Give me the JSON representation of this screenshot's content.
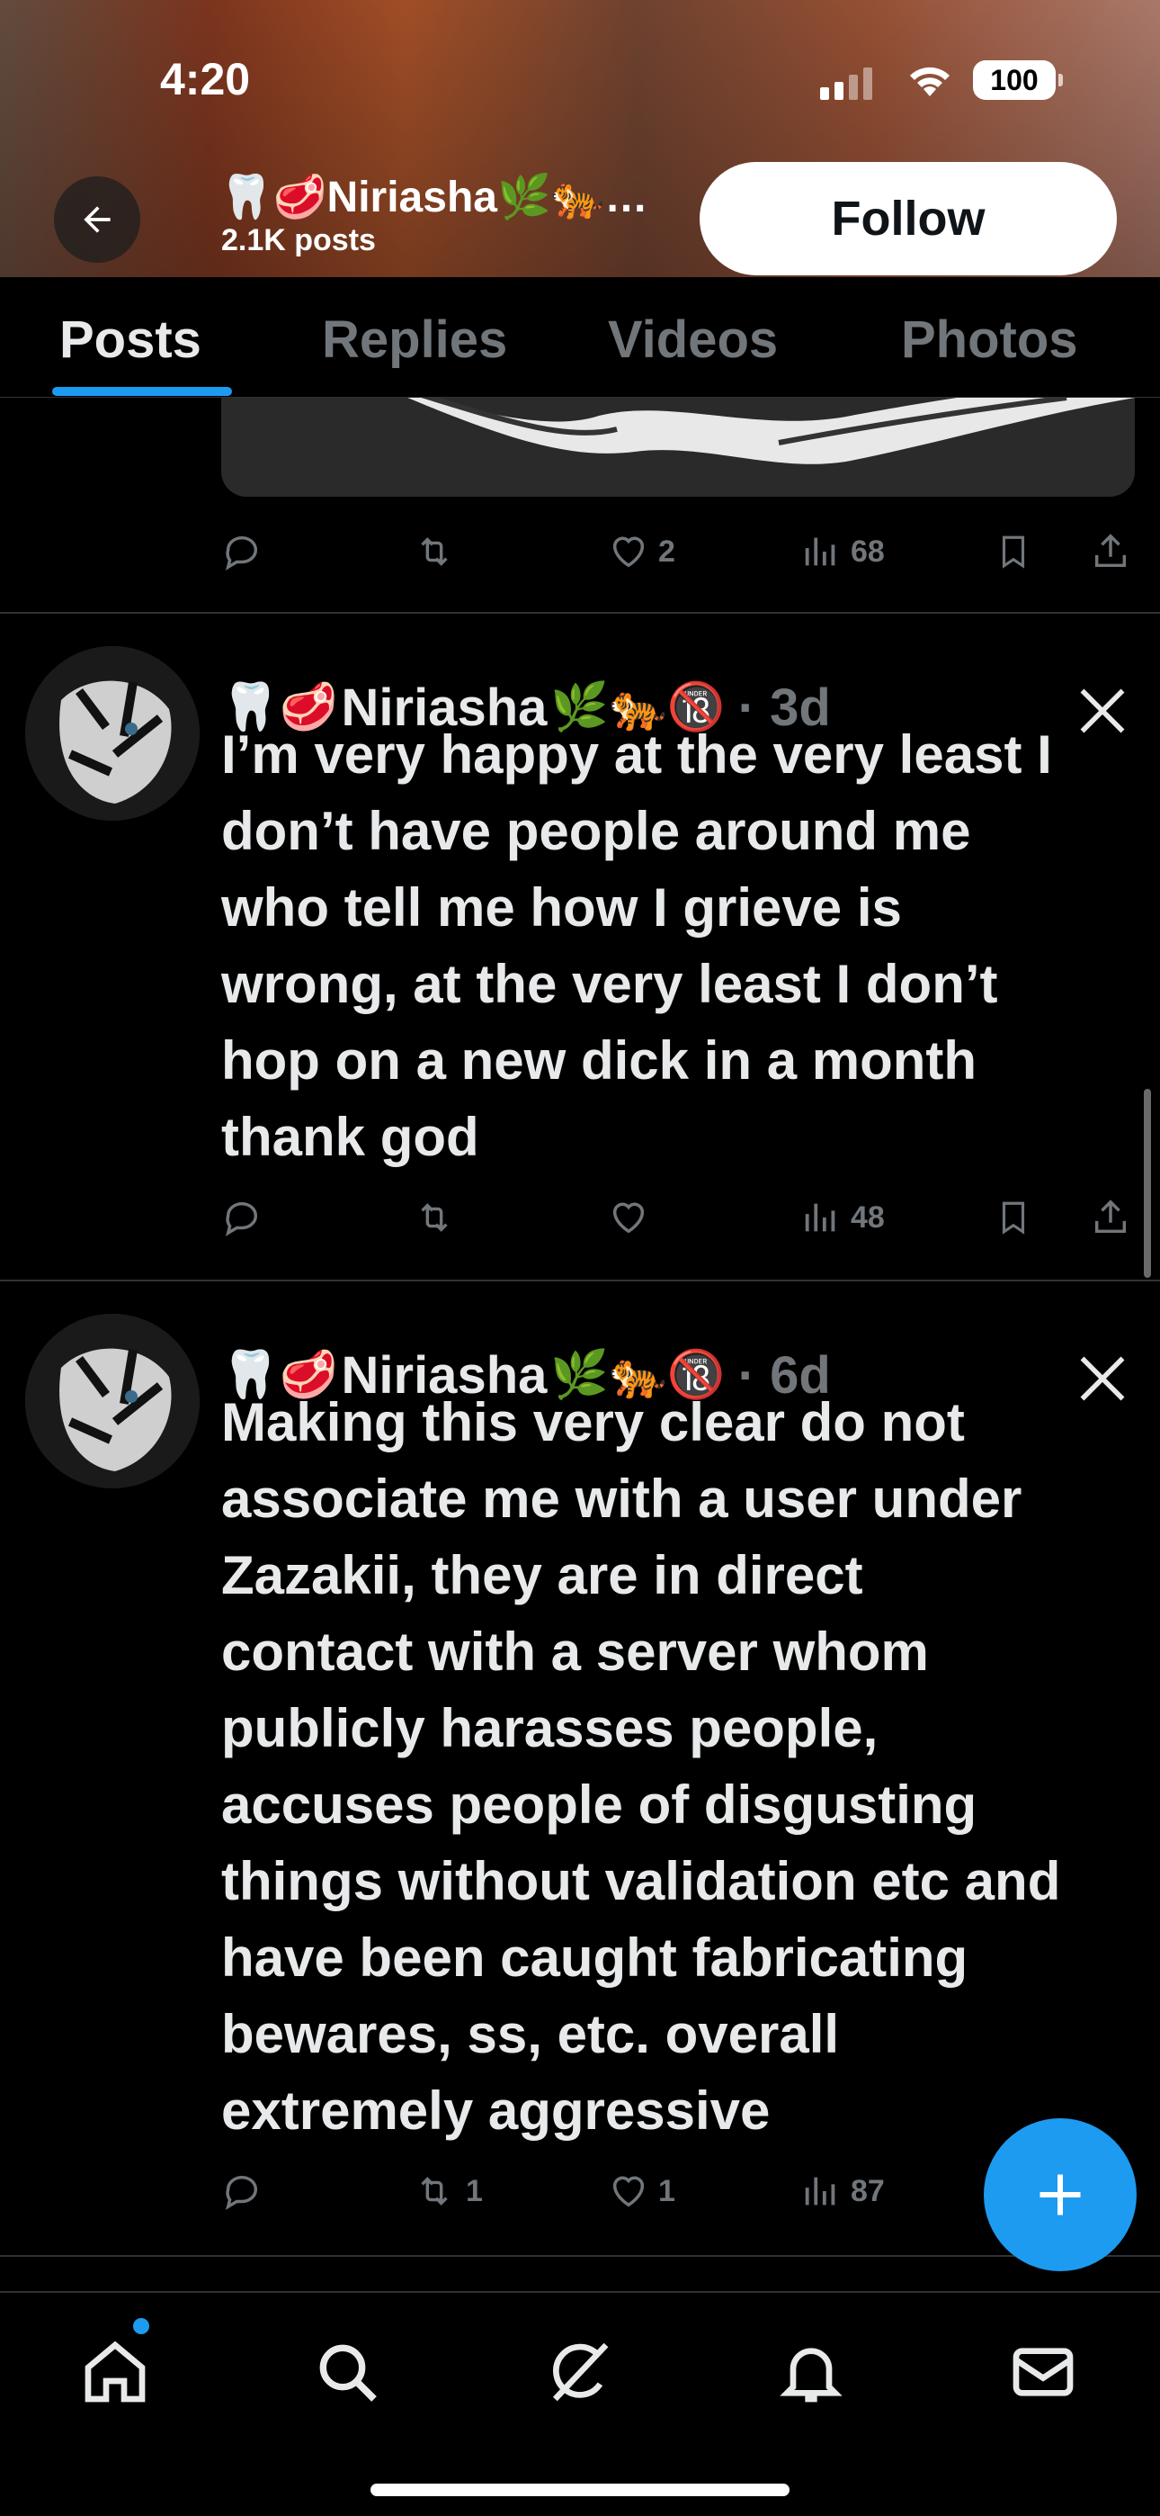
{
  "status_bar": {
    "time": "4:20",
    "battery": "100"
  },
  "profile": {
    "display_name": "🦷🥩Niriasha🌿🐅…",
    "post_count": "2.1K posts",
    "follow_label": "Follow"
  },
  "tabs": [
    {
      "label": "Posts",
      "active": true
    },
    {
      "label": "Replies",
      "active": false
    },
    {
      "label": "Videos",
      "active": false
    },
    {
      "label": "Photos",
      "active": false
    }
  ],
  "prev_post": {
    "likes": "2",
    "views": "68"
  },
  "posts": [
    {
      "name_prefix": "🦷🥩",
      "name": "Niriasha",
      "name_suffix": "🌿🐅🔞",
      "time": "· 3d",
      "text": "I’m very happy at the very least I\ndon’t have people around me\nwho tell me how I grieve is\nwrong, at the very least I don’t\nhop on a new dick in a month\nthank god",
      "replies": "",
      "reposts": "",
      "likes": "",
      "views": "48"
    },
    {
      "name_prefix": "🦷🥩",
      "name": "Niriasha",
      "name_suffix": "🌿🐅🔞",
      "time": "· 6d",
      "text": "Making this very clear do not\nassociate me with a user under\nZazakii, they are in direct\ncontact with a server whom\npublicly harasses people,\naccuses people of disgusting\nthings without validation etc and\nhave been caught fabricating\nbewares, ss, etc. overall\nextremely aggressive",
      "replies": "",
      "reposts": "1",
      "likes": "1",
      "views": "87"
    }
  ],
  "colors": {
    "accent": "#1d9bf0",
    "muted": "#71767b",
    "text": "#e7e9ea",
    "divider": "#2f3336"
  }
}
